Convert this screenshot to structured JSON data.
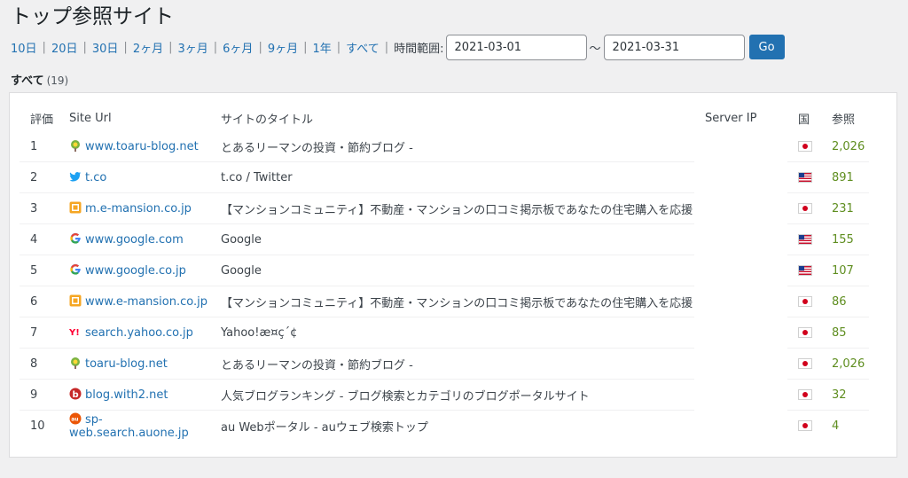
{
  "page": {
    "title": "トップ参照サイト"
  },
  "ranges": {
    "links": [
      "10日",
      "20日",
      "30日",
      "2ヶ月",
      "3ヶ月",
      "6ヶ月",
      "9ヶ月",
      "1年",
      "すべて"
    ],
    "time_range_label": "時間範囲:",
    "start_date": "2021-03-01",
    "end_date": "2021-03-31",
    "tilde": "～",
    "go_label": "Go"
  },
  "filter": {
    "label": "すべて",
    "count": "(19)"
  },
  "table": {
    "headers": {
      "rank": "評価",
      "site_url": "Site Url",
      "site_title": "サイトのタイトル",
      "server_ip": "Server IP",
      "country": "国",
      "referrals": "参照"
    },
    "rows": [
      {
        "rank": "1",
        "favicon": "toaru-blog-icon",
        "url": "www.toaru-blog.net",
        "title": "とあるリーマンの投資・節約ブログ -",
        "country": "jp",
        "refs": "2,026"
      },
      {
        "rank": "2",
        "favicon": "twitter-icon",
        "url": "t.co",
        "title": "t.co / Twitter",
        "country": "us",
        "refs": "891"
      },
      {
        "rank": "3",
        "favicon": "e-mansion-icon",
        "url": "m.e-mansion.co.jp",
        "title": "【マンションコミュニティ】不動産・マンションの口コミ掲示板であなたの住宅購入を応援",
        "country": "jp",
        "refs": "231"
      },
      {
        "rank": "4",
        "favicon": "google-icon",
        "url": "www.google.com",
        "title": "Google",
        "country": "us",
        "refs": "155"
      },
      {
        "rank": "5",
        "favicon": "google-icon",
        "url": "www.google.co.jp",
        "title": "Google",
        "country": "us",
        "refs": "107"
      },
      {
        "rank": "6",
        "favicon": "e-mansion-icon",
        "url": "www.e-mansion.co.jp",
        "title": "【マンションコミュニティ】不動産・マンションの口コミ掲示板であなたの住宅購入を応援",
        "country": "jp",
        "refs": "86"
      },
      {
        "rank": "7",
        "favicon": "yahoo-icon",
        "url": "search.yahoo.co.jp",
        "title": "Yahoo!æ¤ç´¢",
        "country": "jp",
        "refs": "85"
      },
      {
        "rank": "8",
        "favicon": "toaru-blog-icon",
        "url": "toaru-blog.net",
        "title": "とあるリーマンの投資・節約ブログ -",
        "country": "jp",
        "refs": "2,026"
      },
      {
        "rank": "9",
        "favicon": "with2-icon",
        "url": "blog.with2.net",
        "title": "人気ブログランキング - ブログ検索とカテゴリのブログポータルサイト",
        "country": "jp",
        "refs": "32"
      },
      {
        "rank": "10",
        "favicon": "auone-icon",
        "url": "sp-web.search.auone.jp",
        "title": "au Webポータル - auウェブ検索トップ",
        "country": "jp",
        "refs": "4"
      }
    ]
  },
  "colors": {
    "link": "#2271b1",
    "referrals": "#5f8e20",
    "button": "#2271b1"
  }
}
